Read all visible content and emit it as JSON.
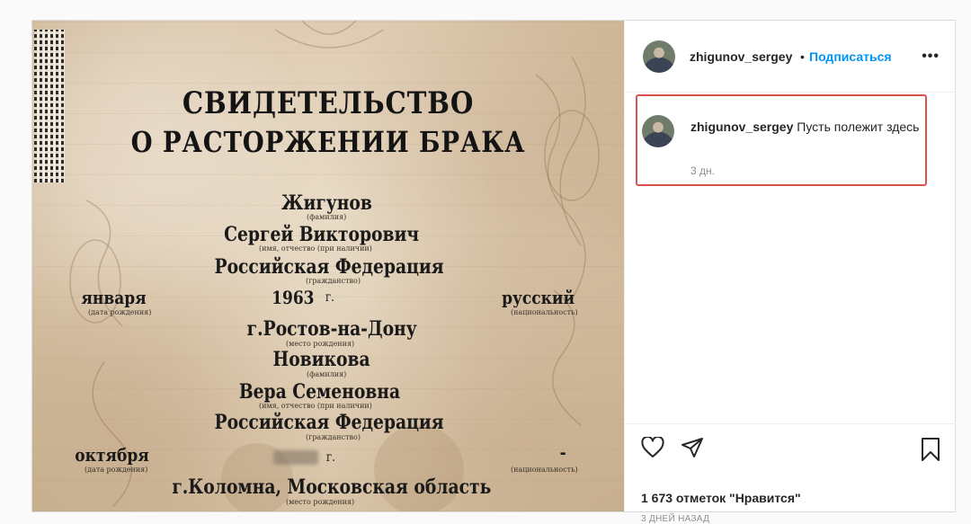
{
  "document": {
    "title_line1": "СВИДЕТЕЛЬСТВО",
    "title_line2": "О РАСТОРЖЕНИИ БРАКА",
    "person1": {
      "surname": "Жигунов",
      "surname_caption": "(фамилия)",
      "name": "Сергей Викторович",
      "name_caption": "(имя, отчество (при наличии)",
      "citizenship": "Российская Федерация",
      "citizenship_caption": "(гражданство)",
      "birth_month": "января",
      "birth_year": "1963",
      "year_suffix": "г.",
      "birth_caption": "(дата рождения)",
      "nationality": "русский",
      "nationality_caption": "(национальность)",
      "birthplace": "г.Ростов-на-Дону",
      "birthplace_caption": "(место рождения)"
    },
    "person2": {
      "surname": "Новикова",
      "surname_caption": "(фамилия)",
      "name": "Вера Семеновна",
      "name_caption": "(имя, отчество (при наличии)",
      "citizenship": "Российская Федерация",
      "citizenship_caption": "(гражданство)",
      "birth_month": "октября",
      "year_suffix": "г.",
      "birth_caption": "(дата рождения)",
      "nationality": "-",
      "nationality_caption": "(национальность)",
      "birthplace": "г.Коломна, Московская область",
      "birthplace_caption": "(место рождения)"
    }
  },
  "header": {
    "username": "zhigunov_sergey",
    "separator": "•",
    "follow_label": "Подписаться",
    "more_icon": "more-horizontal-icon",
    "more_label": "•••"
  },
  "comment": {
    "username": "zhigunov_sergey",
    "text": "Пусть полежит здесь",
    "time": "3 дн.",
    "highlight_color": "#d9534f"
  },
  "actions": {
    "like_icon": "heart-icon",
    "share_icon": "paper-plane-icon",
    "save_icon": "bookmark-icon",
    "likes_text": "1 673 отметок \"Нравится\"",
    "date_text": "3 ДНЕЙ НАЗАД"
  },
  "colors": {
    "accent": "#0095f6",
    "border": "#dbdbdb",
    "muted": "#8e8e8e"
  }
}
